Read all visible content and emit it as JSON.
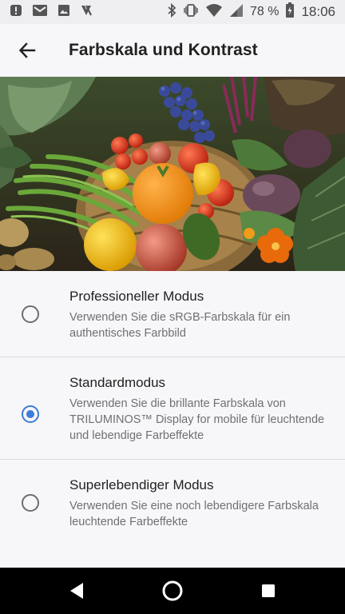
{
  "status_bar": {
    "left_icons": [
      "notification-alert-icon",
      "gmail-icon",
      "photos-icon",
      "clip-icon"
    ],
    "right_icons": [
      "bluetooth-icon",
      "vibrate-icon",
      "wifi-icon",
      "signal-icon",
      "battery-icon"
    ],
    "battery": "78 %",
    "time": "18:06"
  },
  "header": {
    "back_icon": "arrow-back-icon",
    "title": "Farbskala und Kontrast"
  },
  "hero": {
    "image": "vegetable-basket-photo"
  },
  "options": [
    {
      "title": "Professioneller Modus",
      "description": "Verwenden Sie die sRGB-Farbskala für ein authentisches Farbbild",
      "selected": false
    },
    {
      "title": "Standardmodus",
      "description": "Verwenden Sie die brillante Farbskala von TRILUMINOS™ Display for mobile für leuchtende und lebendige Farbeffekte",
      "selected": true
    },
    {
      "title": "Superlebendiger Modus",
      "description": "Verwenden Sie eine noch lebendigere Farbskala leuchtende Farbeffekte",
      "selected": false
    }
  ],
  "nav_bar": {
    "buttons": [
      "back-triangle-icon",
      "home-circle-icon",
      "recents-square-icon"
    ]
  },
  "colors": {
    "accent": "#3d7bd9",
    "background": "#f7f6f9",
    "nav_background": "#000000"
  }
}
